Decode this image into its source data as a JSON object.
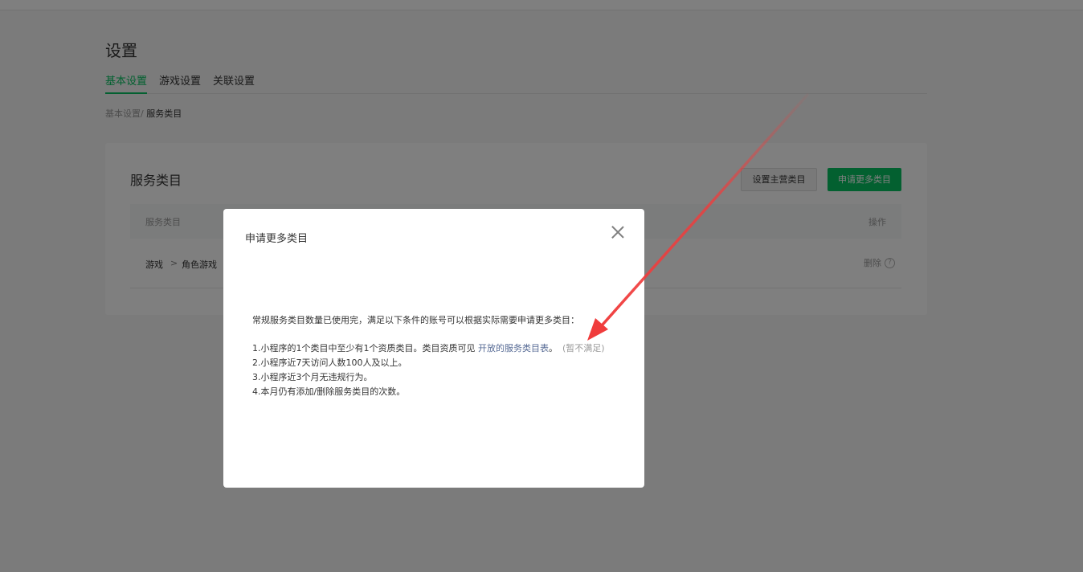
{
  "page": {
    "title": "设置"
  },
  "tabs": [
    {
      "label": "基本设置"
    },
    {
      "label": "游戏设置"
    },
    {
      "label": "关联设置"
    }
  ],
  "breadcrumb": {
    "parent": "基本设置/",
    "current": " 服务类目"
  },
  "card": {
    "title": "服务类目",
    "set_main_label": "设置主营类目",
    "apply_more_label": "申请更多类目",
    "columns": {
      "category": "服务类目",
      "action": "操作"
    },
    "rows": [
      {
        "category": "游戏",
        "separator": ">",
        "subcategory": "角色游戏",
        "action": "删除"
      }
    ]
  },
  "dialog": {
    "title": "申请更多类目",
    "intro": "常规服务类目数量已使用完，满足以下条件的账号可以根据实际需要申请更多类目：",
    "conditions": {
      "c1_text": "1.小程序的1个类目中至少有1个资质类目。类目资质可见 ",
      "c1_link": "开放的服务类目表",
      "c1_end": "。",
      "c1_status": "(暂不满足)",
      "c2": "2.小程序近7天访问人数100人及以上。",
      "c3": "3.小程序近3个月无违规行为。",
      "c4": "4.本月仍有添加/删除服务类目的次数。"
    }
  },
  "colors": {
    "accent": "#07c160",
    "link": "#576b95",
    "annotation": "#f03c3c"
  },
  "icons": {
    "help": "question-circle",
    "close": "x-mark"
  }
}
